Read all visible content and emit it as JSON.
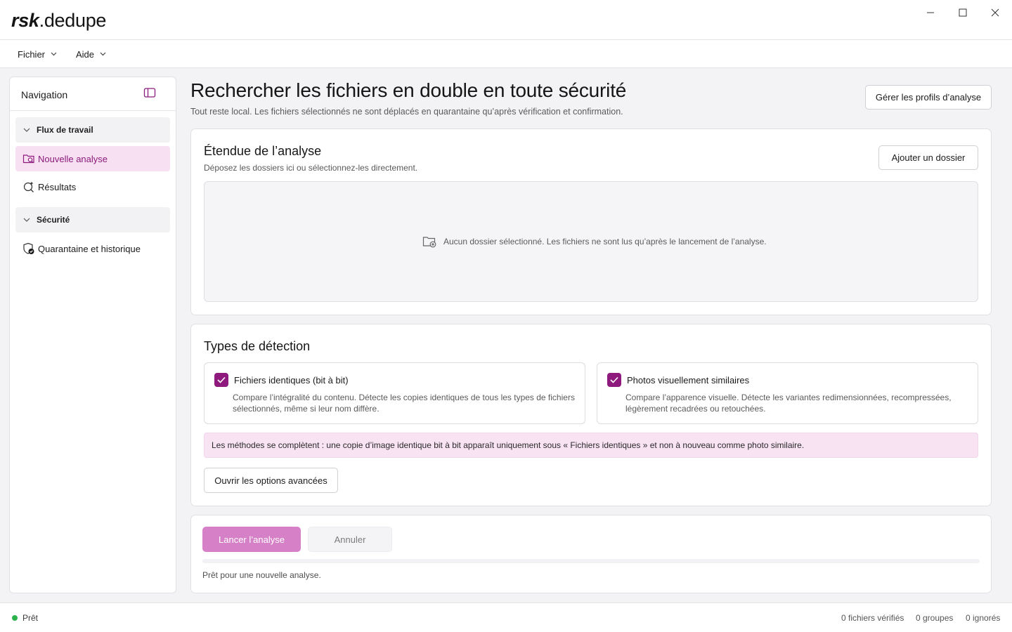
{
  "app": {
    "brand": "rsk",
    "name": ".dedupe"
  },
  "menubar": {
    "items": [
      {
        "label": "Fichier"
      },
      {
        "label": "Aide"
      }
    ]
  },
  "sidebar": {
    "title": "Navigation",
    "groups": [
      {
        "label": "Flux de travail",
        "items": [
          {
            "label": "Nouvelle analyse",
            "icon": "folder-search-icon",
            "active": true
          },
          {
            "label": "Résultats",
            "icon": "sparkle-search-icon",
            "active": false
          }
        ]
      },
      {
        "label": "Sécurité",
        "items": [
          {
            "label": "Quarantaine et historique",
            "icon": "shield-check-icon",
            "active": false
          }
        ]
      }
    ]
  },
  "main": {
    "title": "Rechercher les fichiers en double en toute sécurité",
    "subtitle": "Tout reste local. Les fichiers sélectionnés ne sont déplacés en quarantaine qu’après vérification et confirmation.",
    "profiles_button": "Gérer les profils d’analyse",
    "scope": {
      "title": "Étendue de l’analyse",
      "subtitle": "Déposez les dossiers ici ou sélectionnez-les directement.",
      "add_folder_button": "Ajouter un dossier",
      "empty_message": "Aucun dossier sélectionné. Les fichiers ne sont lus qu’après le lancement de l’analyse."
    },
    "detection": {
      "title": "Types de détection",
      "options": [
        {
          "title": "Fichiers identiques (bit à bit)",
          "description": "Compare l’intégralité du contenu. Détecte les copies identiques de tous les types de fichiers sélectionnés, même si leur nom diffère.",
          "checked": true
        },
        {
          "title": "Photos visuellement similaires",
          "description": "Compare l’apparence visuelle. Détecte les variantes redimensionnées, recompressées, légèrement recadrées ou retouchées.",
          "checked": true
        }
      ],
      "info": "Les méthodes se complètent : une copie d’image identique bit à bit apparaît uniquement sous « Fichiers identiques » et non à nouveau comme photo similaire.",
      "advanced_button": "Ouvrir les options avancées"
    },
    "run": {
      "start_button": "Lancer l’analyse",
      "cancel_button": "Annuler",
      "progress": 0,
      "status": "Prêt pour une nouvelle analyse."
    }
  },
  "statusbar": {
    "state": "Prêt",
    "files_checked": "0 fichiers vérifiés",
    "groups": "0 groupes",
    "ignored": "0 ignorés"
  },
  "colors": {
    "accent": "#8e1a7d",
    "accent_light": "#f7e0f2",
    "run_button": "#d681c7",
    "status_ok": "#2bb24c"
  }
}
